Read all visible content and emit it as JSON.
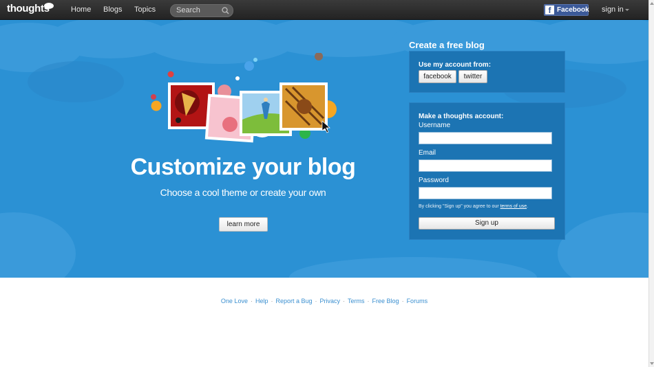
{
  "header": {
    "logo_text": "thoughts",
    "nav": [
      "Home",
      "Blogs",
      "Topics"
    ],
    "search_placeholder": "Search",
    "facebook_label": "Facebook",
    "signin_label": "sign in"
  },
  "hero": {
    "title": "Customize your blog",
    "subtitle": "Choose a cool theme or create your own",
    "learn_more": "learn more",
    "background_color": "#2b91d4"
  },
  "signup": {
    "title": "Create a free blog",
    "use_account_label": "Use my account from:",
    "facebook_button": "facebook",
    "twitter_button": "twitter",
    "make_account_label": "Make a thoughts account:",
    "username_label": "Username",
    "email_label": "Email",
    "password_label": "Password",
    "terms_prefix": "By clicking \"Sign up\" you agree to our ",
    "terms_link": "terms of use",
    "terms_suffix": ".",
    "signup_button": "Sign up"
  },
  "footer": {
    "links": [
      "One Love",
      "Help",
      "Report a Bug",
      "Privacy",
      "Terms",
      "Free Blog",
      "Forums"
    ],
    "separator": "·"
  }
}
